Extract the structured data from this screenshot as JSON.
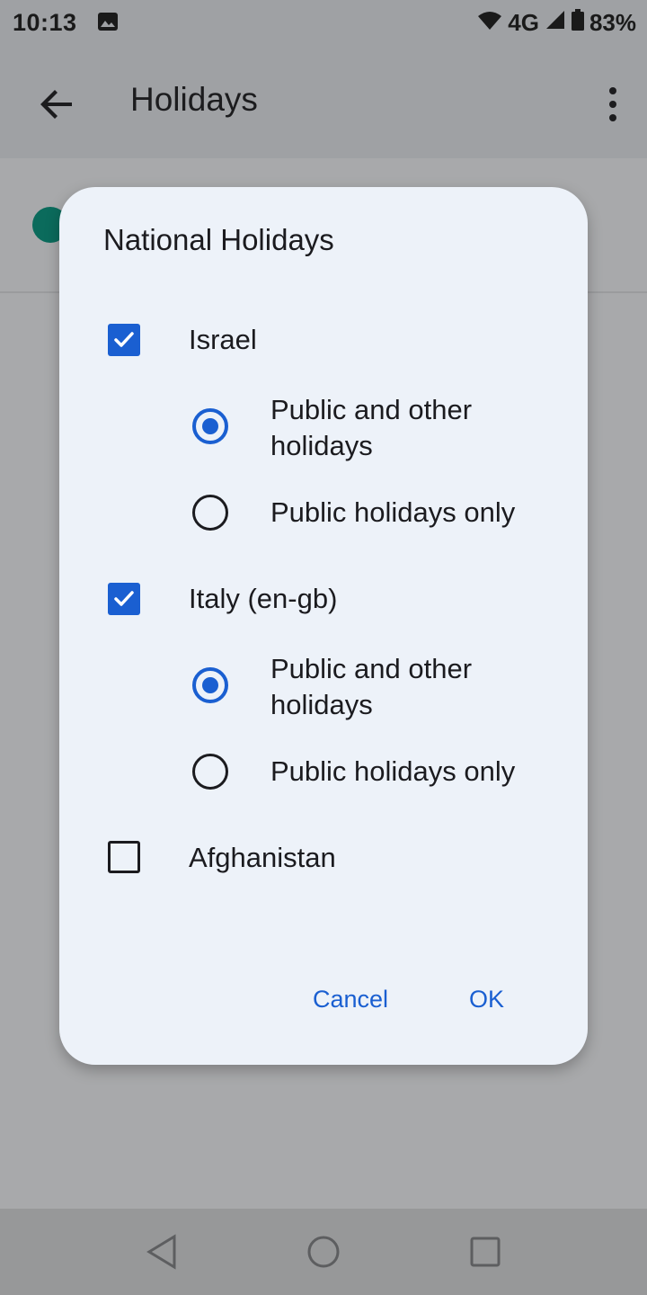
{
  "status_bar": {
    "time": "10:13",
    "network": "4G",
    "battery": "83%"
  },
  "app_bar": {
    "title": "Holidays",
    "back_icon": "arrow-back-icon",
    "menu_icon": "more-vert-icon"
  },
  "dialog": {
    "title": "National Holidays",
    "countries": [
      {
        "name": "Israel",
        "checked": true,
        "options": [
          "Public and other holidays",
          "Public holidays only"
        ],
        "selected": 0
      },
      {
        "name": "Italy (en-gb)",
        "checked": true,
        "options": [
          "Public and other holidays",
          "Public holidays only"
        ],
        "selected": 0
      },
      {
        "name": "Afghanistan",
        "checked": false
      }
    ],
    "cancel_label": "Cancel",
    "ok_label": "OK"
  },
  "colors": {
    "accent": "#1a5fd1",
    "dialog_bg": "#edf2f9",
    "scrim": "#a8a9ab"
  }
}
